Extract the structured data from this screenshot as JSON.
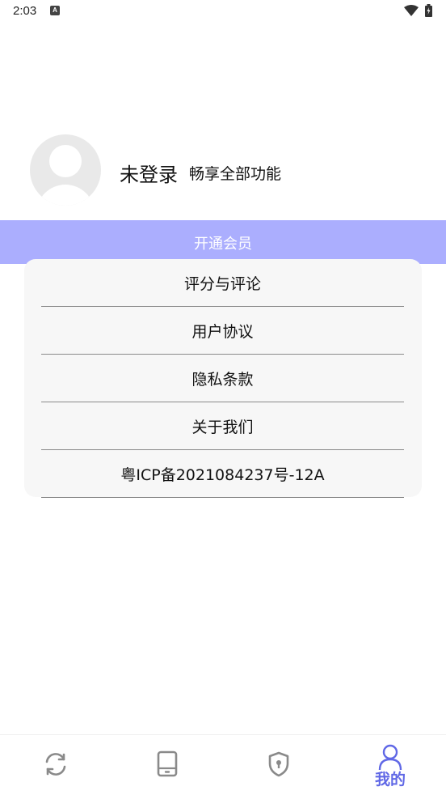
{
  "status_bar": {
    "time": "2:03",
    "app_icon": "A"
  },
  "profile": {
    "login_status": "未登录",
    "subtitle": "畅享全部功能"
  },
  "vip": {
    "label": "开通会员",
    "color": "#abaefe"
  },
  "menu": {
    "items": [
      {
        "label": "评分与评论"
      },
      {
        "label": "用户协议"
      },
      {
        "label": "隐私条款"
      },
      {
        "label": "关于我们"
      },
      {
        "label": "粤ICP备2021084237号-12A"
      }
    ]
  },
  "nav": {
    "items": [
      {
        "icon": "sync-icon"
      },
      {
        "icon": "tablet-icon"
      },
      {
        "icon": "shield-icon"
      },
      {
        "icon": "person-icon",
        "label": "我的",
        "active": true
      }
    ],
    "active_color": "#6068e6",
    "inactive_color": "#8a8a8a"
  }
}
